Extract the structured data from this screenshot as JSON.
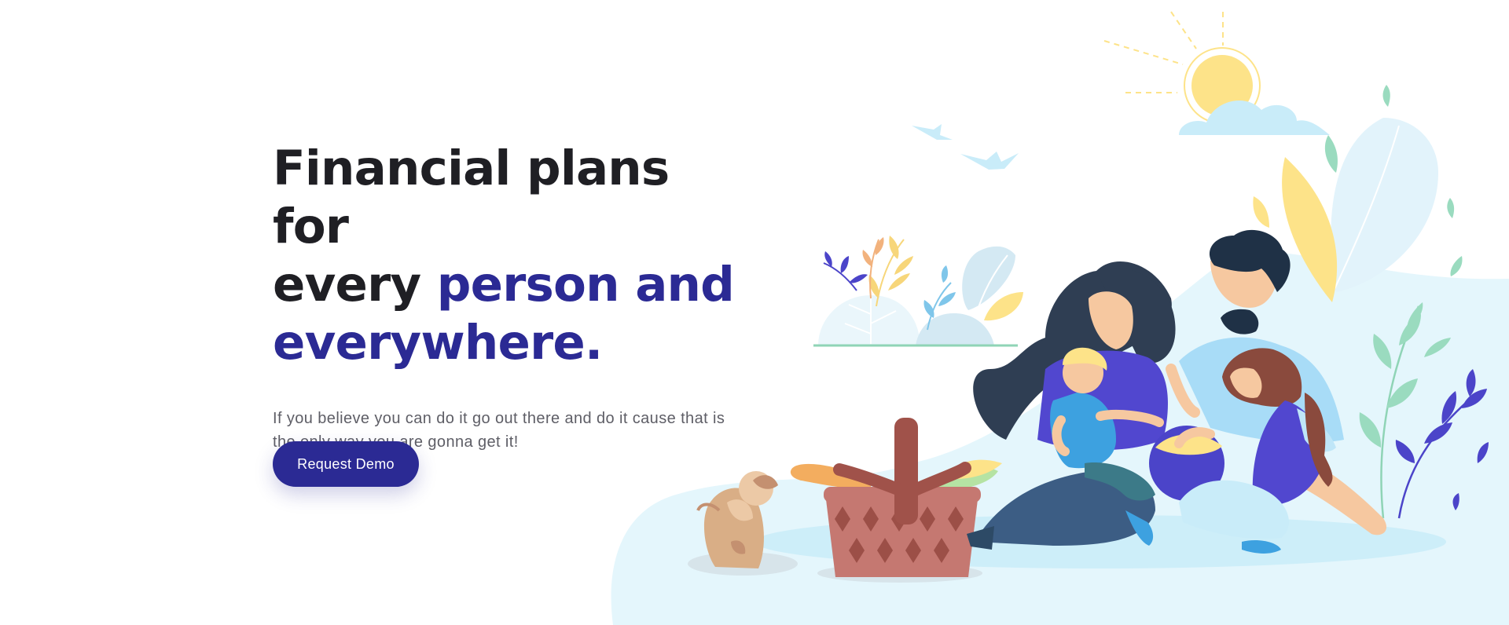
{
  "hero": {
    "title_line1": "Financial plans for",
    "title_line2_plain": "every ",
    "title_line2_accent": "person and",
    "title_line3_accent": "everywhere.",
    "subtitle": "If you believe you can do it go out there and do it cause that is the only way you are gonna get it!",
    "cta_label": "Request Demo"
  },
  "colors": {
    "primary": "#2b2a94",
    "heading": "#1f1f24",
    "body_text": "#5e5e66",
    "ground": "#e4f6fc",
    "sun": "#fde389"
  },
  "illustration": {
    "subject": "family-picnic-scene",
    "icons": [
      "sun-icon",
      "cloud-icon",
      "bird-icon",
      "leaf-icon",
      "picnic-basket-icon",
      "dog-icon"
    ]
  }
}
